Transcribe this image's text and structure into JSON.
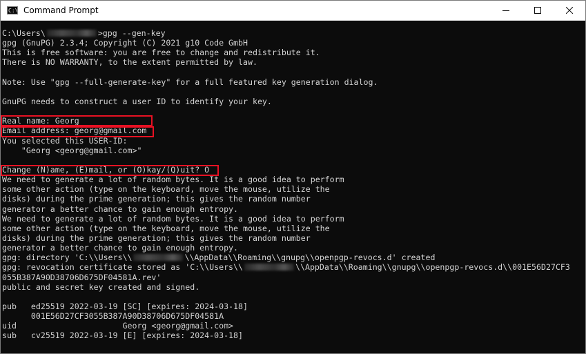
{
  "window": {
    "title": "Command Prompt",
    "icon": "C:\\",
    "controls": {
      "minimize": "minimize-icon",
      "maximize": "maximize-icon",
      "close": "close-icon"
    }
  },
  "terminal": {
    "colors": {
      "background": "#0c0c0c",
      "foreground": "#d4d4d4",
      "highlight": "#e81123"
    },
    "lines": [
      [
        "C:\\Users\\",
        "•",
        ">gpg --gen-key"
      ],
      "gpg (GnuPG) 2.3.4; Copyright (C) 2021 g10 Code GmbH",
      "This is free software: you are free to change and redistribute it.",
      "There is NO WARRANTY, to the extent permitted by law.",
      "",
      "Note: Use \"gpg --full-generate-key\" for a full featured key generation dialog.",
      "",
      "GnuPG needs to construct a user ID to identify your key.",
      "",
      "Real name: Georg",
      "Email address: georg@gmail.com",
      "You selected this USER-ID:",
      "    \"Georg <georg@gmail.com>\"",
      "",
      "Change (N)ame, (E)mail, or (O)kay/(Q)uit? O",
      "We need to generate a lot of random bytes. It is a good idea to perform",
      "some other action (type on the keyboard, move the mouse, utilize the",
      "disks) during the prime generation; this gives the random number",
      "generator a better chance to gain enough entropy.",
      "We need to generate a lot of random bytes. It is a good idea to perform",
      "some other action (type on the keyboard, move the mouse, utilize the",
      "disks) during the prime generation; this gives the random number",
      "generator a better chance to gain enough entropy.",
      [
        "gpg: directory 'C:\\\\Users\\\\",
        "•",
        "\\\\AppData\\\\Roaming\\\\gnupg\\\\openpgp-revocs.d' created"
      ],
      [
        "gpg: revocation certificate stored as 'C:\\\\Users\\\\",
        "•",
        "\\\\AppData\\\\Roaming\\\\gnupg\\\\openpgp-revocs.d\\\\001E56D27CF3"
      ],
      "055B387A90D38706D675DF04581A.rev'",
      "public and secret key created and signed.",
      "",
      "pub   ed25519 2022-03-19 [SC] [expires: 2024-03-18]",
      "      001E56D27CF3055B387A90D38706D675DF04581A",
      "uid                      Georg <georg@gmail.com>",
      "sub   cv25519 2022-03-19 [E] [expires: 2024-03-18]"
    ]
  }
}
